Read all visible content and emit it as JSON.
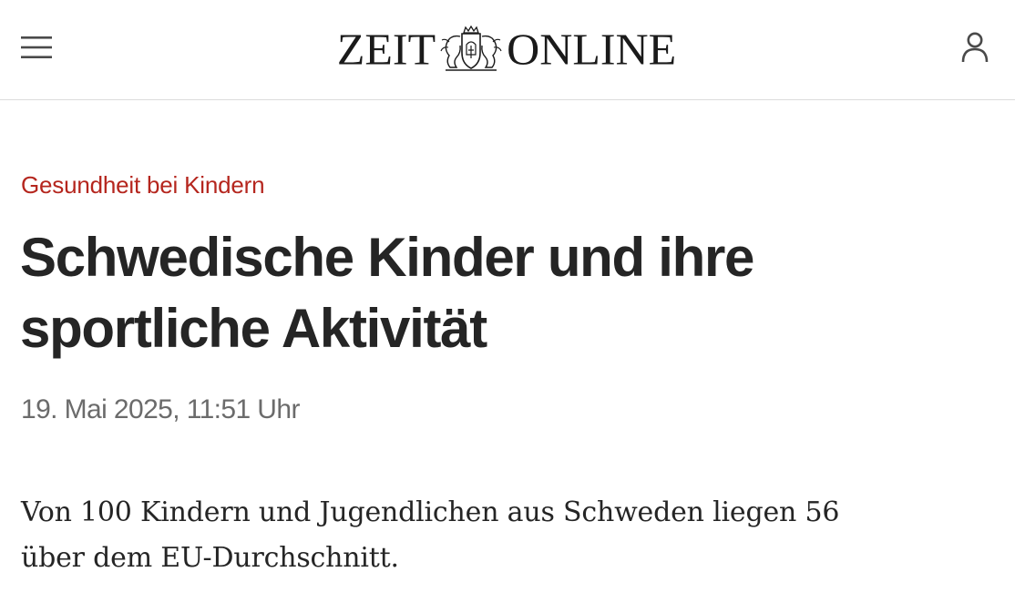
{
  "header": {
    "logo_left": "ZEIT",
    "logo_right": "ONLINE",
    "menu_icon": "hamburger-menu-icon",
    "account_icon": "user-account-icon"
  },
  "article": {
    "kicker": "Gesundheit bei Kindern",
    "headline_line1": "Schwedische Kinder und ihre",
    "headline_line2": "sportliche Aktivität",
    "dateline": "19. Mai 2025, 11:51 Uhr",
    "summary_line1": "Von 100 Kindern und Jugendlichen aus Schweden liegen 56",
    "summary_line2": "über dem EU-Durchschnitt."
  },
  "colors": {
    "kicker": "#b5261e",
    "text": "#252525",
    "muted": "#6b6b6b",
    "divider": "#dcdcdc"
  }
}
